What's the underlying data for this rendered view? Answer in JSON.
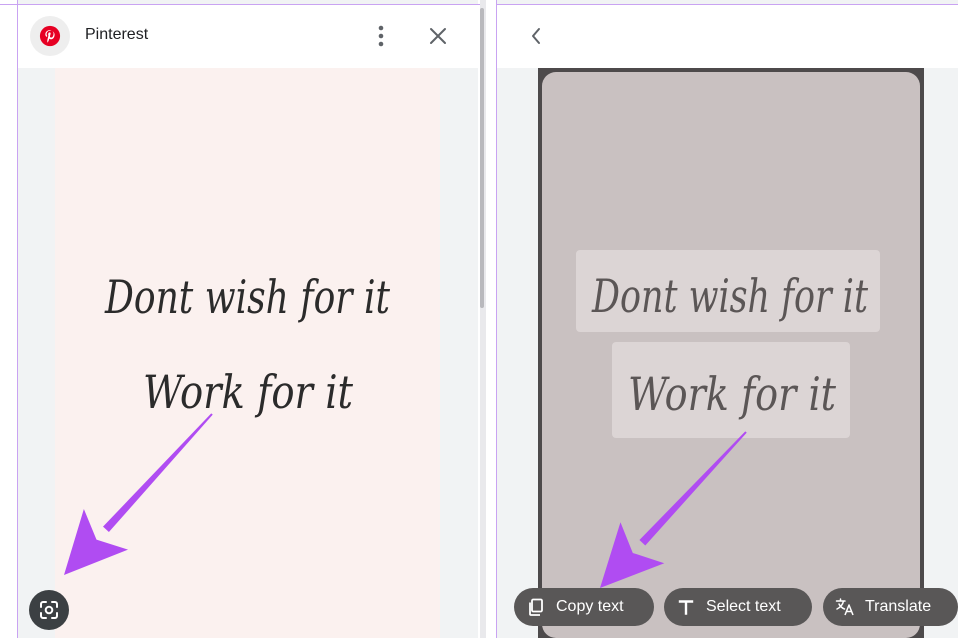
{
  "left_panel": {
    "header": {
      "title": "Pinterest",
      "logo_icon": "pinterest-logo-icon",
      "menu_icon": "more-vertical-icon",
      "close_icon": "close-icon"
    },
    "image_text_lines": [
      "Dont wish for it",
      "Work for it"
    ],
    "lens_icon": "google-lens-icon"
  },
  "right_panel": {
    "header": {
      "back_icon": "chevron-left-icon"
    },
    "detected_text_lines": [
      "Dont wish for it",
      "Work for it"
    ],
    "actions": [
      {
        "label": "Copy text",
        "icon": "copy-icon"
      },
      {
        "label": "Select text",
        "icon": "text-t-icon"
      },
      {
        "label": "Translate",
        "icon": "translate-icon"
      }
    ]
  },
  "annotation": {
    "arrow_color": "#b04cf2"
  },
  "colors": {
    "pinterest_red": "#e60023",
    "image_background": "#fbf1ef",
    "lens_overlay": "#c9c1c1"
  }
}
